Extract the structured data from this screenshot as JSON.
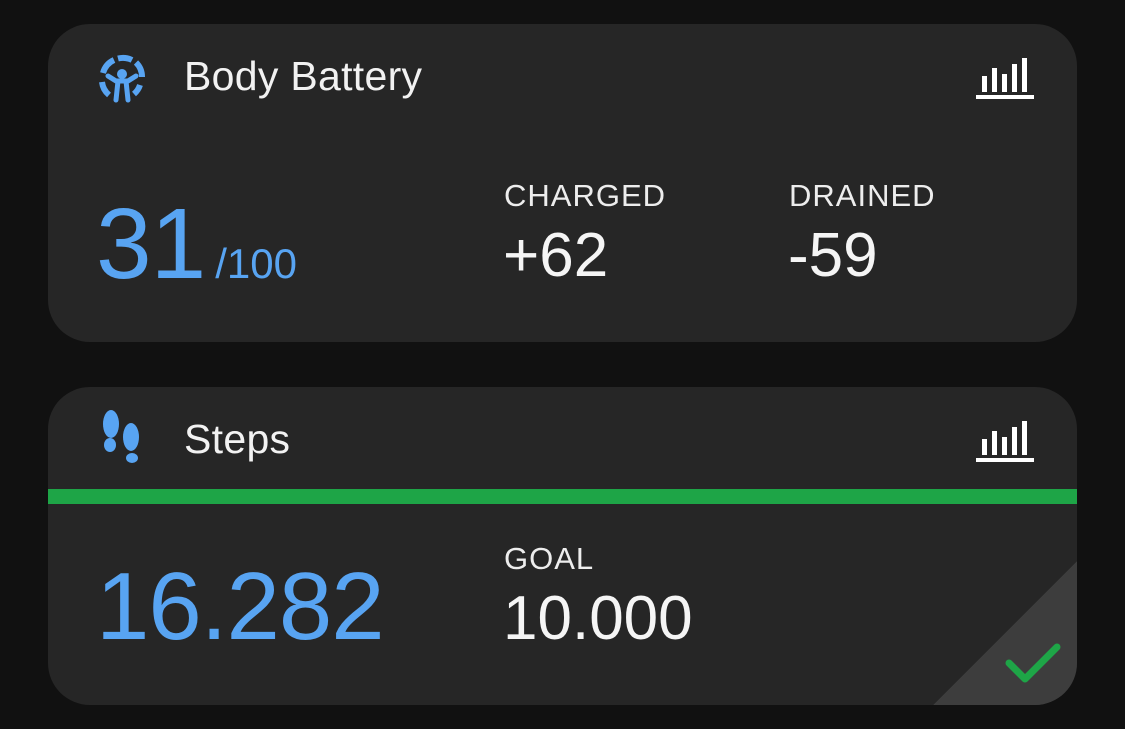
{
  "body_battery": {
    "title": "Body Battery",
    "icon": "body-battery-icon",
    "value": "31",
    "value_suffix": "/100",
    "charged_label": "CHARGED",
    "charged_value": "+62",
    "drained_label": "DRAINED",
    "drained_value": "-59"
  },
  "steps": {
    "title": "Steps",
    "icon": "footprints-icon",
    "value": "16.282",
    "goal_label": "GOAL",
    "goal_value": "10.000",
    "progress_fraction": 1.0,
    "goal_reached": true
  },
  "colors": {
    "background": "#111111",
    "card": "#262626",
    "accent_blue": "#58a4f2",
    "progress_green": "#1ea547",
    "check_green": "#1ea547"
  }
}
